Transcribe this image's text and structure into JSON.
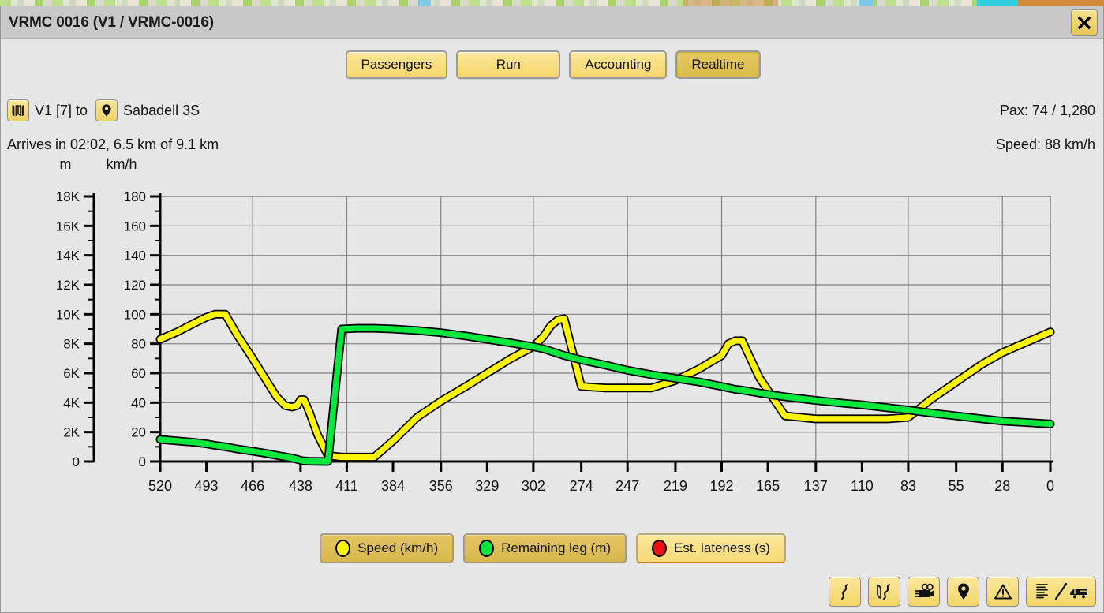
{
  "window": {
    "title": "VRMC 0016 (V1 / VRMC-0016)",
    "close_label": "close-icon"
  },
  "tabs": [
    {
      "label": "Passengers",
      "active": false
    },
    {
      "label": "Run",
      "active": false
    },
    {
      "label": "Accounting",
      "active": false
    },
    {
      "label": "Realtime",
      "active": true
    }
  ],
  "info": {
    "line_icon": "book-route-icon",
    "line_label": "V1 [7] to",
    "dest_icon": "map-pin-icon",
    "dest_label": "Sabadell 3S",
    "pax": "Pax: 74 / 1,280",
    "arrival": "Arrives in 02:02, 6.5 km of 9.1 km",
    "speed": "Speed: 88 km/h"
  },
  "axis_units": {
    "left": "m",
    "right": "km/h"
  },
  "legend": [
    {
      "label": "Speed (km/h)",
      "color": "#FFF500",
      "active": true
    },
    {
      "label": "Remaining leg (m)",
      "color": "#00E83C",
      "active": true
    },
    {
      "label": "Est. lateness (s)",
      "color": "#F01010",
      "active": false
    }
  ],
  "toolbar": [
    {
      "icon": "winding-road-icon",
      "wide": false
    },
    {
      "icon": "route-split-icon",
      "wide": false
    },
    {
      "icon": "video-camera-icon",
      "wide": false
    },
    {
      "icon": "map-pin-icon",
      "wide": false
    },
    {
      "icon": "warning-triangle-icon",
      "wide": false
    },
    {
      "icon": "timetable-train-icon",
      "wide": true
    }
  ],
  "colors": {
    "accent": "#F4D76A",
    "speed": "#FFF500",
    "remaining": "#00E83C",
    "lateness": "#F01010",
    "titlebar": "#C8C8C8",
    "body": "#E6E6E6"
  },
  "chart_data": {
    "type": "line",
    "title": "",
    "xlabel": "",
    "ylabel": "m",
    "y2label": "km/h",
    "grid": true,
    "legend_position": "bottom",
    "xlim": [
      520,
      0
    ],
    "ylim": [
      0,
      18000
    ],
    "y2lim": [
      0,
      180
    ],
    "x_ticks": [
      520,
      493,
      466,
      438,
      411,
      384,
      356,
      329,
      302,
      274,
      247,
      219,
      192,
      165,
      137,
      110,
      83,
      55,
      28,
      0
    ],
    "y_ticks_left": [
      "0",
      "2K",
      "4K",
      "6K",
      "8K",
      "10K",
      "12K",
      "14K",
      "16K",
      "18K"
    ],
    "y_ticks_right": [
      0,
      20,
      40,
      60,
      80,
      100,
      120,
      140,
      160,
      180
    ],
    "x": [
      520,
      510,
      500,
      493,
      488,
      482,
      475,
      466,
      458,
      452,
      447,
      443,
      440,
      438,
      436,
      433,
      428,
      422,
      414,
      405,
      395,
      384,
      370,
      356,
      340,
      329,
      315,
      302,
      296,
      292,
      288,
      284,
      274,
      260,
      247,
      233,
      219,
      205,
      192,
      188,
      184,
      180,
      170,
      155,
      137,
      120,
      110,
      95,
      83,
      70,
      55,
      40,
      28,
      14,
      0
    ],
    "series": [
      {
        "name": "Speed (km/h)",
        "axis": "right",
        "unit": "km/h",
        "color": "#FFF500",
        "values": [
          83,
          88,
          94,
          98,
          100,
          100,
          86,
          70,
          55,
          44,
          38,
          37,
          38,
          42,
          42,
          34,
          18,
          4,
          3,
          3,
          3,
          14,
          30,
          41,
          52,
          60,
          70,
          78,
          85,
          92,
          96,
          97,
          51,
          50,
          50,
          50,
          55,
          63,
          72,
          80,
          82,
          82,
          57,
          31,
          29,
          29,
          29,
          29,
          30,
          42,
          54,
          66,
          74,
          81,
          88
        ]
      },
      {
        "name": "Remaining leg (m)",
        "axis": "left",
        "unit": "m",
        "color": "#00E83C",
        "values": [
          1500,
          1400,
          1300,
          1200,
          1100,
          1000,
          850,
          700,
          550,
          420,
          320,
          230,
          150,
          80,
          40,
          20,
          10,
          0,
          9000,
          9050,
          9050,
          9000,
          8900,
          8750,
          8500,
          8300,
          8050,
          7800,
          7650,
          7500,
          7350,
          7200,
          6900,
          6550,
          6200,
          5900,
          5650,
          5400,
          5100,
          5000,
          4900,
          4850,
          4650,
          4400,
          4150,
          3950,
          3850,
          3650,
          3500,
          3300,
          3100,
          2900,
          2750,
          2650,
          2550
        ]
      },
      {
        "name": "Est. lateness (s)",
        "axis": "right",
        "unit": "s",
        "color": "#F01010",
        "values": [],
        "hidden": true
      }
    ]
  }
}
